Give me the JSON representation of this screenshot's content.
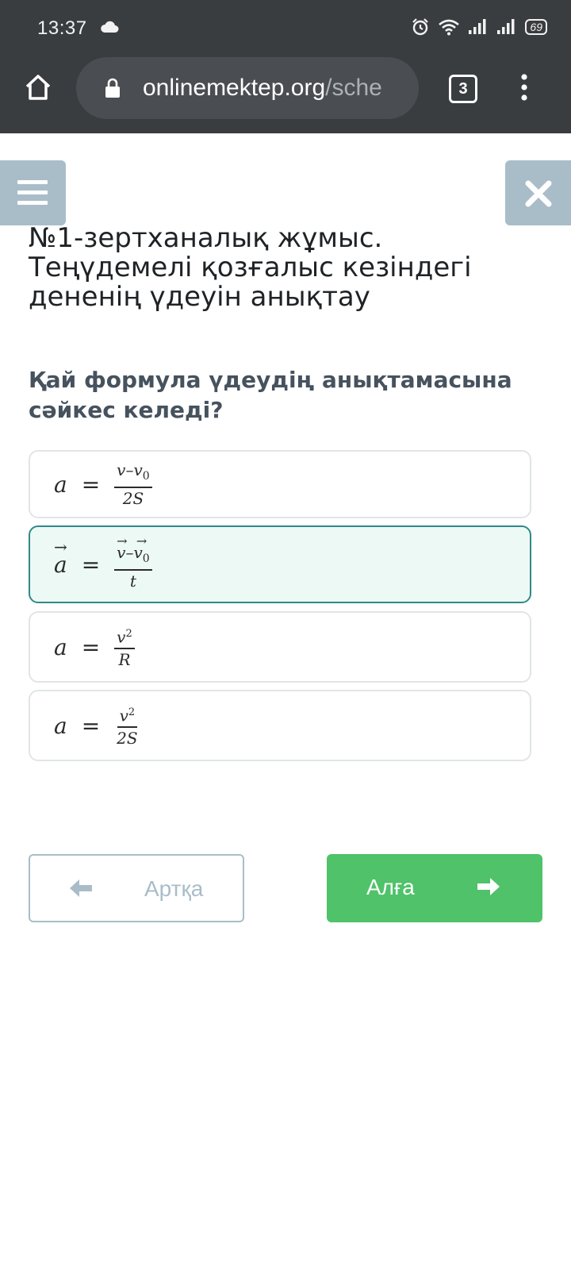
{
  "status_bar": {
    "time": "13:37",
    "battery": "69",
    "icons": [
      "cloud-icon",
      "alarm-icon",
      "wifi-icon",
      "signal-icon",
      "signal-icon",
      "battery-icon"
    ]
  },
  "browser": {
    "url_domain": "onlinemektep.org",
    "url_rest": "/sche",
    "tab_count": "3",
    "icons": [
      "home-icon",
      "lock-icon",
      "more-vertical-icon"
    ]
  },
  "app": {
    "lesson_title": "№1-зертханалық жұмыс. Теңүдемелі қозғалыс кезіндегі дененің үдеуін анықтау",
    "question": "Қай формула үдеудің анықтамасына сәйкес келеді?",
    "selected_option": 1,
    "options": [
      {
        "lhs": "a",
        "eq": "=",
        "num_a": "v",
        "num_op": "–",
        "num_b": "v",
        "num_sub": "0",
        "den": "2S"
      },
      {
        "lhs": "a",
        "eq": "=",
        "num_a": "v",
        "num_op": "–",
        "num_b": "v",
        "num_sub": "0",
        "den": "t"
      },
      {
        "lhs": "a",
        "eq": "=",
        "num": "v",
        "num_sup": "2",
        "den": "R"
      },
      {
        "lhs": "a",
        "eq": "=",
        "num": "v",
        "num_sup": "2",
        "den": "2S"
      }
    ],
    "back_label": "Артқа",
    "next_label": "Алға",
    "colors": {
      "accent_green": "#4fc26a",
      "selected_border": "#2e8b88",
      "selected_bg": "#edf9f5",
      "side_button": "#a9bdc9"
    }
  }
}
